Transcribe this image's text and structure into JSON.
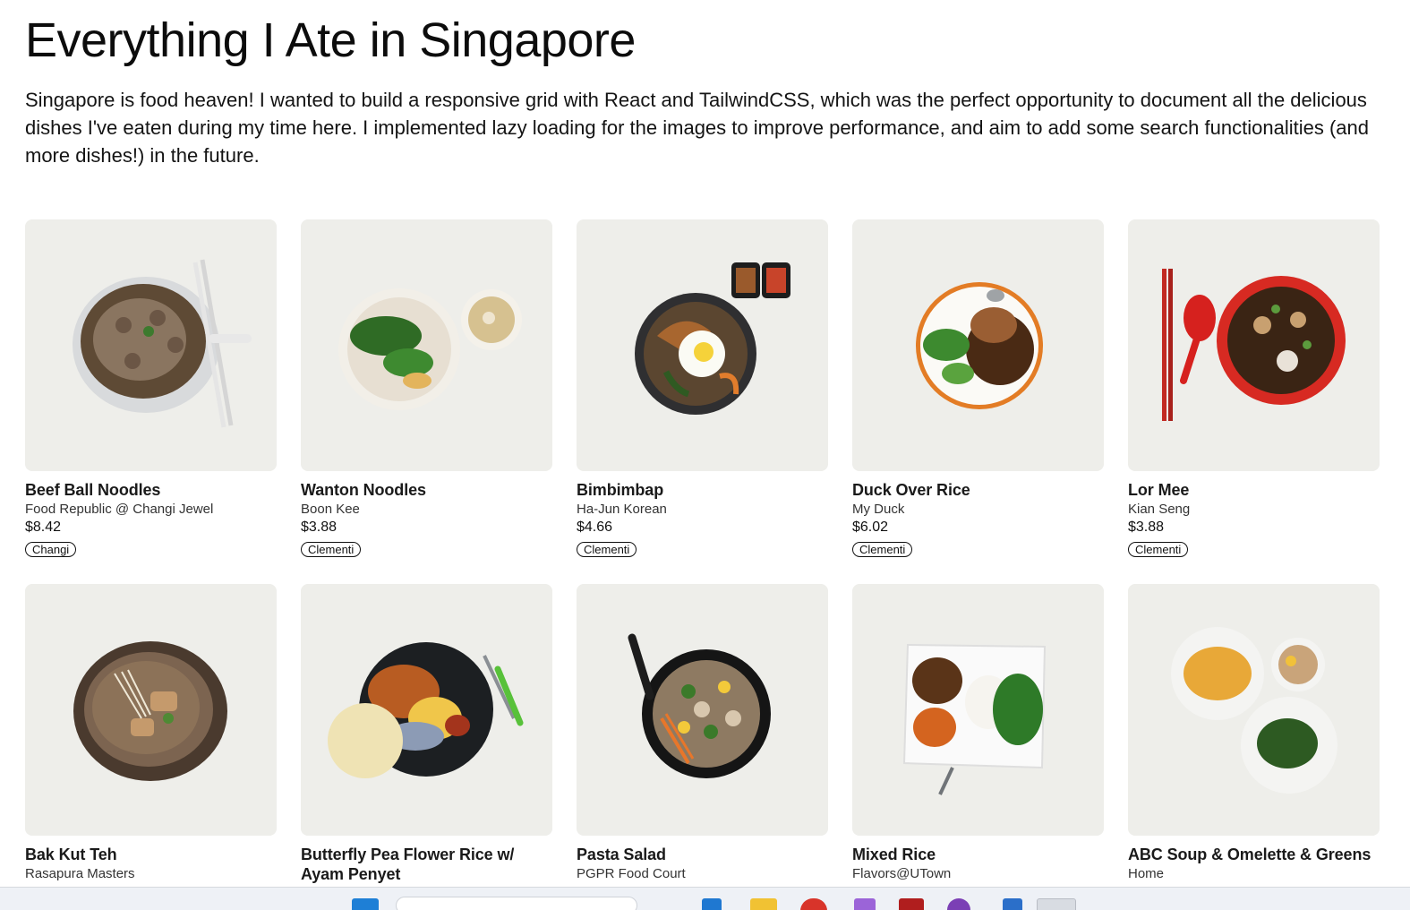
{
  "header": {
    "title": "Everything I Ate in Singapore",
    "intro": "Singapore is food heaven! I wanted to build a responsive grid with React and TailwindCSS, which was the perfect opportunity to document all the delicious dishes I've eaten during my time here. I implemented lazy loading for the images to improve performance, and aim to add some search functionalities (and more dishes!) in the future."
  },
  "dishes": [
    {
      "name": "Beef Ball Noodles",
      "place": "Food Republic @ Changi Jewel",
      "price": "$8.42",
      "tag": "Changi"
    },
    {
      "name": "Wanton Noodles",
      "place": "Boon Kee",
      "price": "$3.88",
      "tag": "Clementi"
    },
    {
      "name": "Bimbimbap",
      "place": "Ha-Jun Korean",
      "price": "$4.66",
      "tag": "Clementi"
    },
    {
      "name": "Duck Over Rice",
      "place": "My Duck",
      "price": "$6.02",
      "tag": "Clementi"
    },
    {
      "name": "Lor Mee",
      "place": "Kian Seng",
      "price": "$3.88",
      "tag": "Clementi"
    },
    {
      "name": "Bak Kut Teh",
      "place": "Rasapura Masters",
      "price": "",
      "tag": ""
    },
    {
      "name": "Butterfly Pea Flower Rice w/ Ayam Penyet",
      "place": "",
      "price": "",
      "tag": ""
    },
    {
      "name": "Pasta Salad",
      "place": "PGPR Food Court",
      "price": "",
      "tag": ""
    },
    {
      "name": "Mixed Rice",
      "place": "Flavors@UTown",
      "price": "",
      "tag": ""
    },
    {
      "name": "ABC Soup & Omelette & Greens",
      "place": "Home",
      "price": "",
      "tag": ""
    }
  ],
  "colors": {
    "photo_background": "#eeeeea",
    "text": "#111111",
    "taskbar": "#eef1f6"
  },
  "taskbar": {
    "icons": [
      "windows-icon",
      "search-bar",
      "file-explorer-icon",
      "browser-icon",
      "app-icon"
    ]
  }
}
